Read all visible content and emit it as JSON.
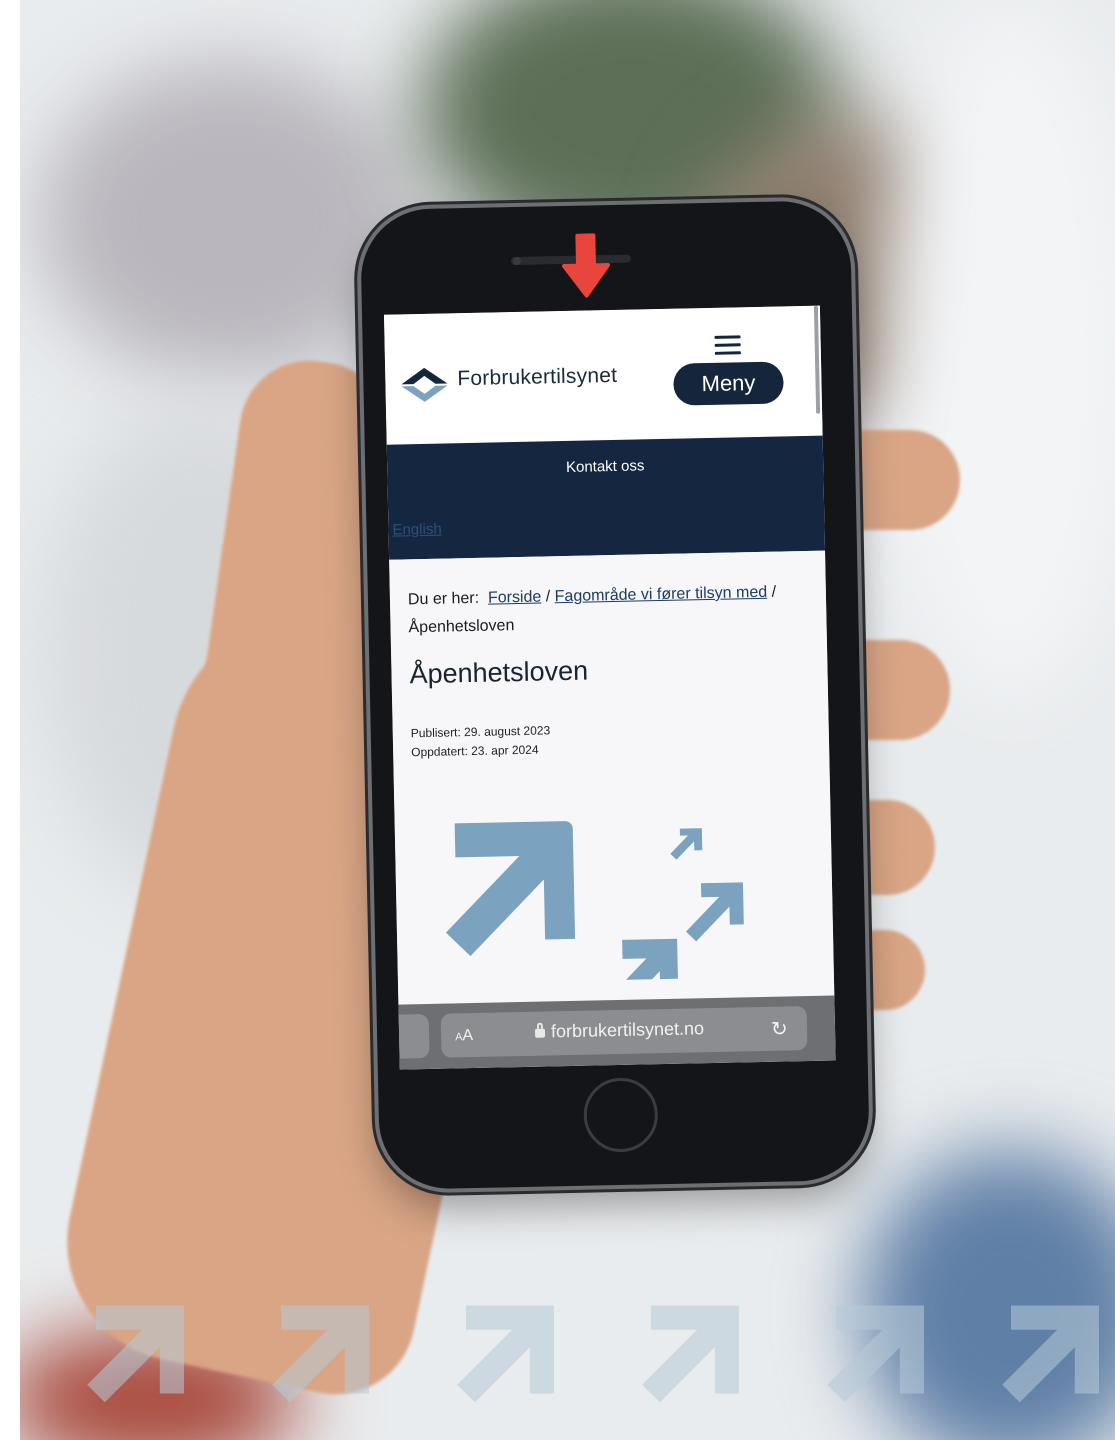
{
  "phone": {
    "site": {
      "logo_text": "Forbrukertilsynet",
      "menu_label": "Meny",
      "nav": {
        "contact": "Kontakt oss",
        "english": "English"
      },
      "breadcrumb": {
        "prefix": "Du er her:",
        "items": [
          "Forside",
          "Fagområde vi fører tilsyn med",
          "Åpenhetsloven"
        ],
        "separator": "/"
      },
      "page_title": "Åpenhetsloven",
      "published": "Publisert: 29. august 2023",
      "updated": "Oppdatert: 23. apr 2024"
    },
    "browser": {
      "text_size": "AA",
      "url": "forbrukertilsynet.no"
    }
  },
  "colors": {
    "navy": "#142640",
    "arrow_blue": "#7ba2bf",
    "indicator_red": "#e8453c"
  },
  "icons": [
    "arrow-down-icon",
    "menu-icon",
    "lock-icon",
    "reload-icon"
  ]
}
